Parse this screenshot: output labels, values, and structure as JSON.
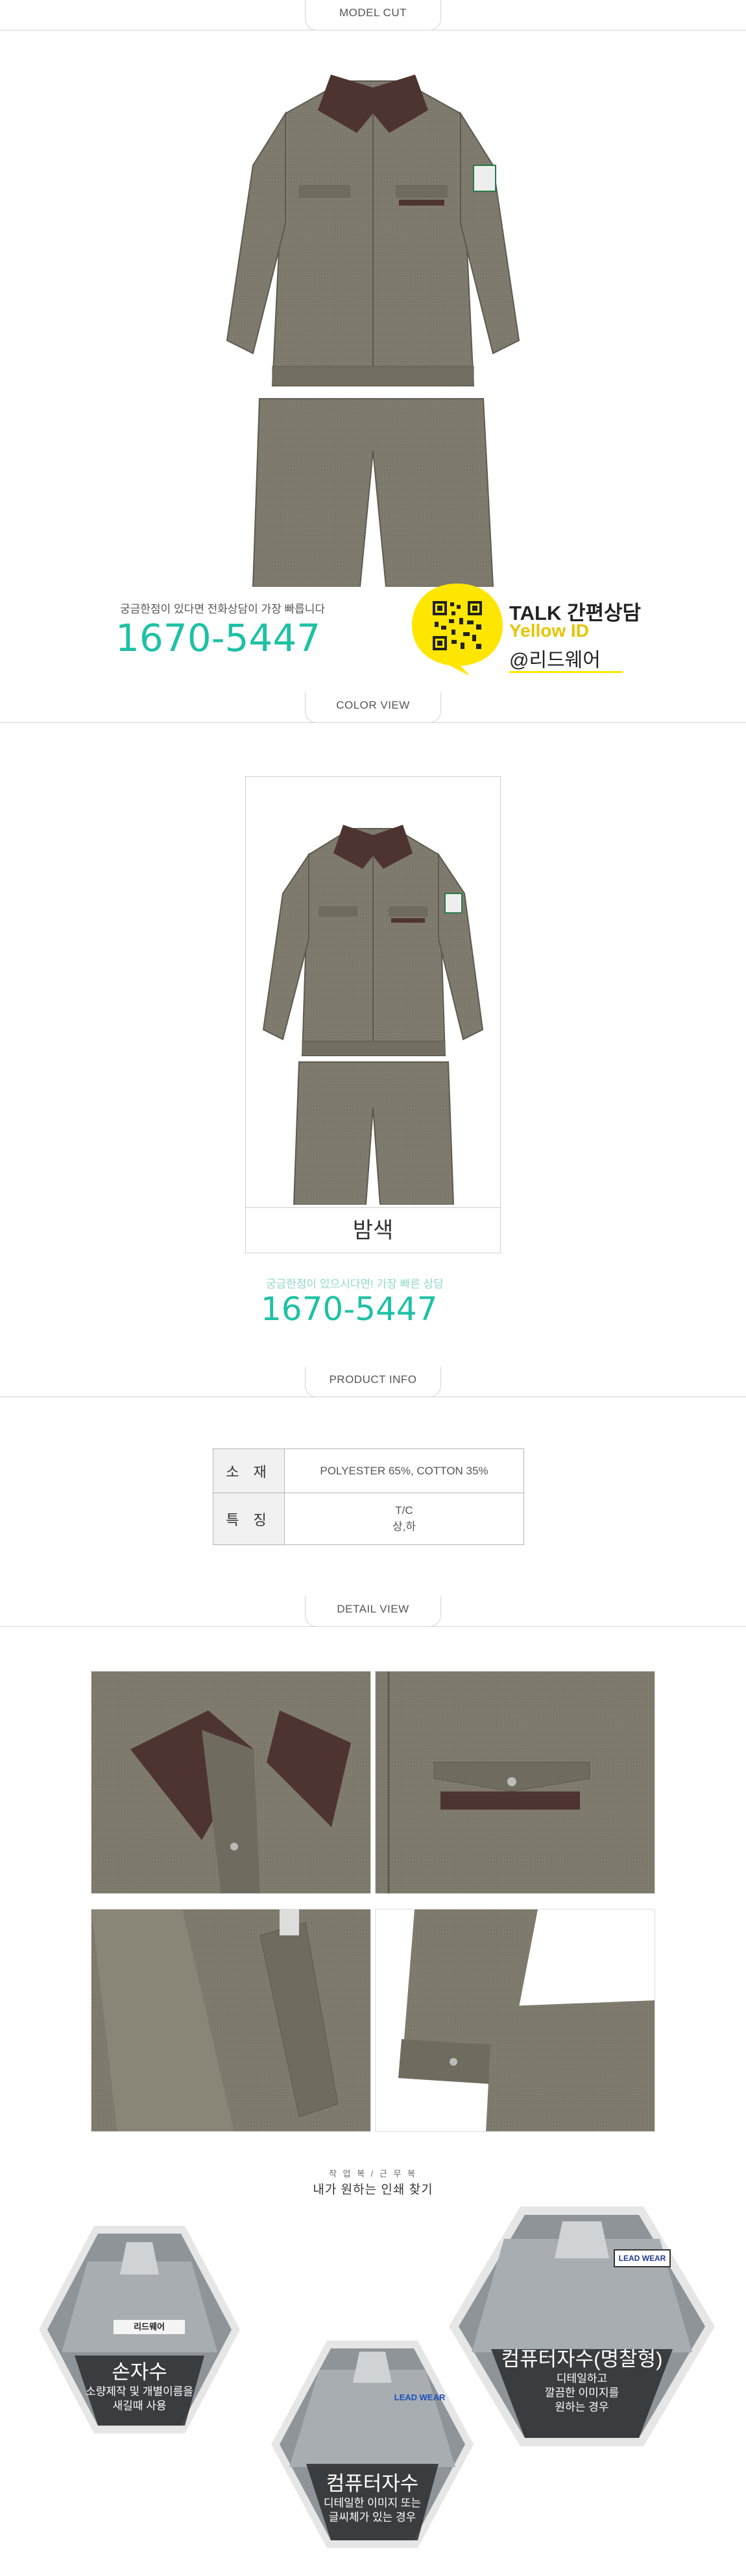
{
  "sections": {
    "model_cut": "MODEL CUT",
    "color_view": "COLOR VIEW",
    "product_info": "PRODUCT INFO",
    "detail_view": "DETAIL VIEW"
  },
  "contact": {
    "ask_text": "궁금한점이 있다면 전화상담이 가장 빠릅니다",
    "phone": "1670-5447",
    "talk_title": "TALK 간편상담",
    "yellow_id": "Yellow ID",
    "kakao_id": "@리드웨어"
  },
  "color_view": {
    "color_name": "밤색",
    "ask_text": "궁금한점이 있으시다면! 가장 빠른 상담",
    "phone": "1670-5447"
  },
  "product_info": {
    "rows": [
      {
        "label": "소 재",
        "value": "POLYESTER 65%, COTTON 35%"
      },
      {
        "label": "특 징",
        "value_line1": "T/C",
        "value_line2": "상,하"
      }
    ]
  },
  "print": {
    "heading_small": "작 업 복 / 근 무 복",
    "heading": "내가 원하는 인쇄 찾기",
    "cards": [
      {
        "title": "손자수",
        "desc1": "소량제작 및 개별이름을",
        "desc2": "새길때 사용",
        "patch": "리드웨어"
      },
      {
        "title": "컴퓨터자수",
        "desc1": "디테일한 이미지 또는",
        "desc2": "글씨체가 있는 경우",
        "patch": "LEAD WEAR"
      },
      {
        "title": "컴퓨터자수(명찰형)",
        "desc1": "디테일하고",
        "desc2": "깔끔한 이미지를",
        "desc3": "원하는 경우",
        "patch": "LEAD WEAR"
      }
    ]
  },
  "colors": {
    "teal": "#1fc1a5",
    "kakao_yellow": "#ffe600",
    "fabric": "#7d7a6d",
    "collar": "#4e3430"
  }
}
